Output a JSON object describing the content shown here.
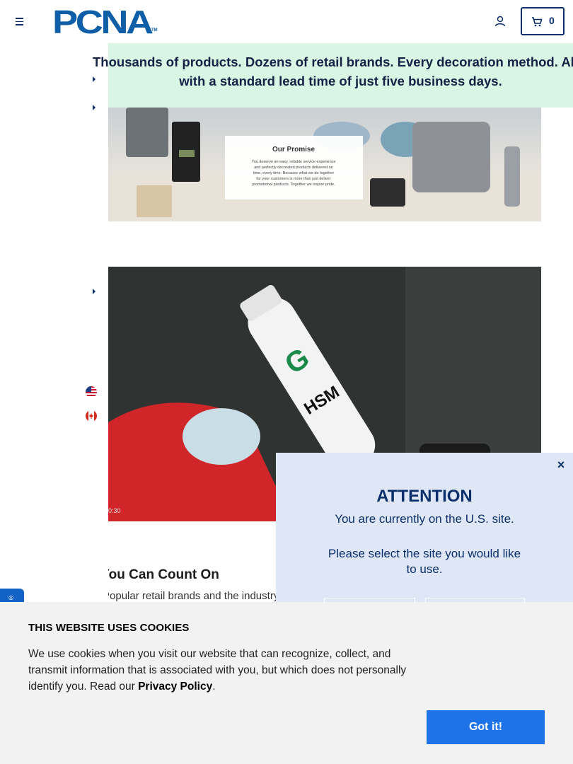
{
  "header": {
    "logo_text": "PCNA",
    "logo_tm": "TM",
    "cart_count": "0",
    "colors": {
      "brand": "#0e5fa8",
      "navy": "#0b2f6b"
    }
  },
  "banner": {
    "line1": "Thousands of products. Dozens of retail brands. Every decoration method. All",
    "line2": "with a standard lead time of just five business days.",
    "background": "#d9f6e4"
  },
  "promise_image": {
    "title": "Our Promise",
    "body": "You deserve an easy, reliable service experience and perfectly decorated products delivered on time, every time. Because what we do together for your customers is more than just deliver promotional products. Together we inspire pride."
  },
  "video": {
    "time": "0:30",
    "bottle_text": "HSM"
  },
  "section": {
    "heading": "Brands You Can Count On",
    "body": "Popular retail brands and the industry's"
  },
  "modal": {
    "title": "ATTENTION",
    "line1": "You are currently on the U.S. site.",
    "line2": "Please select the site you would like to use.",
    "close": "×"
  },
  "cookie": {
    "title": "THIS WEBSITE USES COOKIES",
    "body_before": "We use cookies when you visit our website that can recognize, collect, and transmit information that is associated with you, but which does not personally identify you. Read our ",
    "link": "Privacy Policy",
    "body_after": ".",
    "button": "Got it!",
    "button_color": "#1e73e8"
  }
}
